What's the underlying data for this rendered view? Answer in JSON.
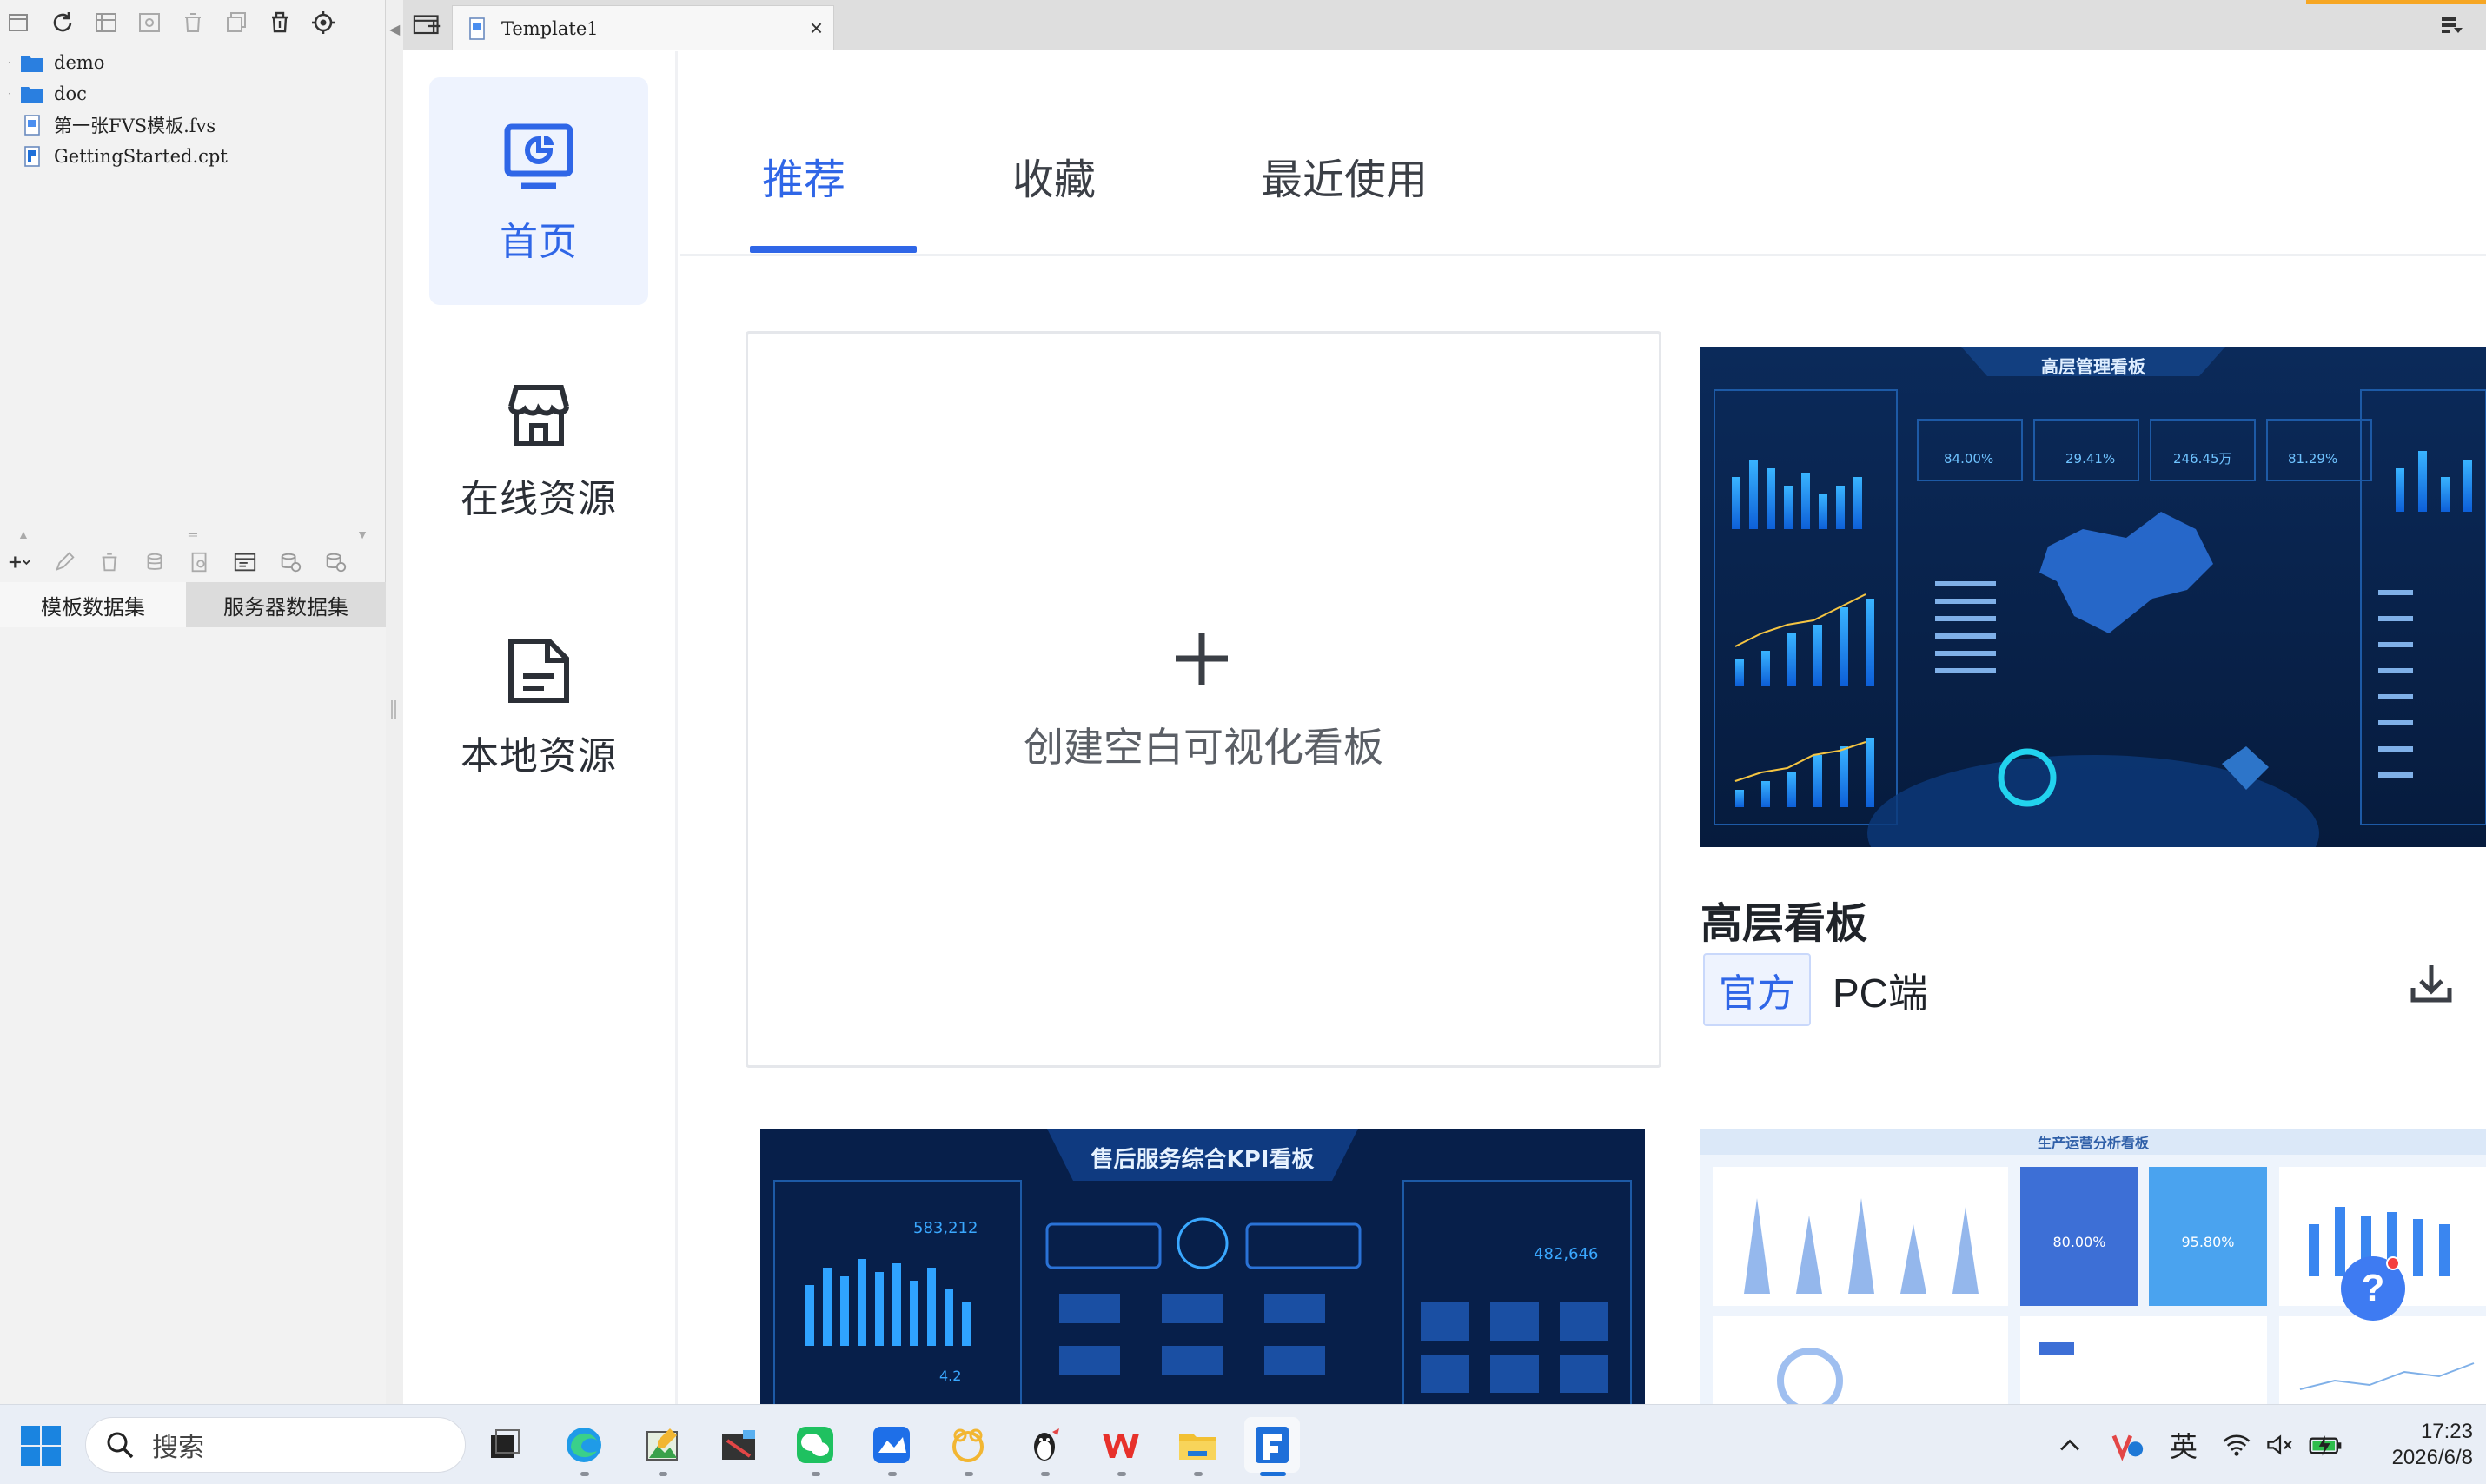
{
  "window": {
    "tab_title": "Template1",
    "accent": "#2f66e7"
  },
  "left_panel": {
    "tree": [
      {
        "label": "demo",
        "type": "folder"
      },
      {
        "label": "doc",
        "type": "folder"
      },
      {
        "label": "第一张FVS模板.fvs",
        "type": "fvs-file"
      },
      {
        "label": "GettingStarted.cpt",
        "type": "cpt-file"
      }
    ],
    "dataset_tabs": [
      "模板数据集",
      "服务器数据集"
    ]
  },
  "nav": {
    "items": [
      {
        "label": "首页",
        "icon": "home-chart-icon",
        "active": true
      },
      {
        "label": "在线资源",
        "icon": "store-icon",
        "active": false
      },
      {
        "label": "本地资源",
        "icon": "local-file-icon",
        "active": false
      }
    ]
  },
  "tabs": [
    {
      "label": "推荐",
      "active": true
    },
    {
      "label": "收藏",
      "active": false
    },
    {
      "label": "最近使用",
      "active": false
    }
  ],
  "create_card": {
    "label": "创建空白可视化看板"
  },
  "templates": [
    {
      "title": "高层看板",
      "badge": "官方",
      "platform": "PC端",
      "preview_heading": "高层管理看板",
      "preview_values": [
        "84.00%",
        "29.41%",
        "246.45万",
        "81.29%"
      ]
    },
    {
      "preview_heading": "售后服务综合KPI看板",
      "preview_values": [
        "583,212",
        "482,646",
        "4.2"
      ]
    },
    {
      "preview_heading": "生产运营分析看板",
      "preview_values": [
        "80.00%",
        "95.80%"
      ]
    }
  ],
  "help": {
    "label": "?"
  },
  "taskbar": {
    "search_placeholder": "搜索",
    "ime": "英",
    "time": "17:23",
    "date": "2026/6/8"
  }
}
